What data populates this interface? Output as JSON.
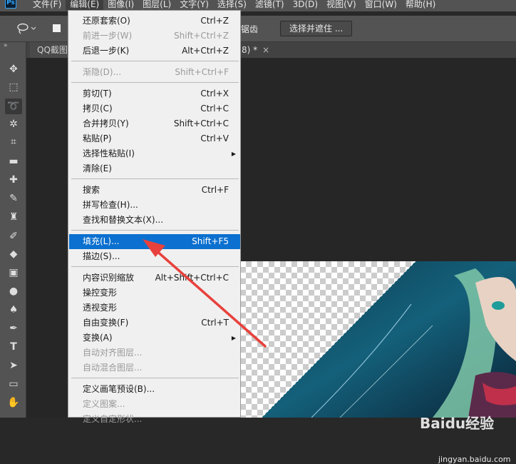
{
  "app": {
    "logo": "Ps"
  },
  "menubar": {
    "items": [
      {
        "label": "文件(F)"
      },
      {
        "label": "编辑(E)"
      },
      {
        "label": "图像(I)"
      },
      {
        "label": "图层(L)"
      },
      {
        "label": "文字(Y)"
      },
      {
        "label": "选择(S)"
      },
      {
        "label": "滤镜(T)"
      },
      {
        "label": "3D(D)"
      },
      {
        "label": "视图(V)"
      },
      {
        "label": "窗口(W)"
      },
      {
        "label": "帮助(H)"
      }
    ]
  },
  "options": {
    "antialias_label": "锯齿",
    "select_mask_button": "选择并遮住 ..."
  },
  "tabs": {
    "tab1": "QQ截图",
    "tab2": "8) *",
    "tab2_close": "×"
  },
  "edit_menu": {
    "items": [
      {
        "label": "还原套索(O)",
        "shortcut": "Ctrl+Z"
      },
      {
        "label": "前进一步(W)",
        "shortcut": "Shift+Ctrl+Z"
      },
      {
        "label": "后退一步(K)",
        "shortcut": "Alt+Ctrl+Z"
      },
      {
        "label": "渐隐(D)...",
        "shortcut": "Shift+Ctrl+F"
      },
      {
        "label": "剪切(T)",
        "shortcut": "Ctrl+X"
      },
      {
        "label": "拷贝(C)",
        "shortcut": "Ctrl+C"
      },
      {
        "label": "合并拷贝(Y)",
        "shortcut": "Shift+Ctrl+C"
      },
      {
        "label": "粘贴(P)",
        "shortcut": "Ctrl+V"
      },
      {
        "label": "选择性粘贴(I)",
        "shortcut": ""
      },
      {
        "label": "清除(E)",
        "shortcut": ""
      },
      {
        "label": "搜索",
        "shortcut": "Ctrl+F"
      },
      {
        "label": "拼写检查(H)...",
        "shortcut": ""
      },
      {
        "label": "查找和替换文本(X)...",
        "shortcut": ""
      },
      {
        "label": "填充(L)...",
        "shortcut": "Shift+F5"
      },
      {
        "label": "描边(S)...",
        "shortcut": ""
      },
      {
        "label": "内容识别缩放",
        "shortcut": "Alt+Shift+Ctrl+C"
      },
      {
        "label": "操控变形",
        "shortcut": ""
      },
      {
        "label": "透视变形",
        "shortcut": ""
      },
      {
        "label": "自由变换(F)",
        "shortcut": "Ctrl+T"
      },
      {
        "label": "变换(A)",
        "shortcut": ""
      },
      {
        "label": "自动对齐图层...",
        "shortcut": ""
      },
      {
        "label": "自动混合图层...",
        "shortcut": ""
      },
      {
        "label": "定义画笔预设(B)...",
        "shortcut": ""
      },
      {
        "label": "定义图案...",
        "shortcut": ""
      },
      {
        "label": "定义自定形状...",
        "shortcut": ""
      }
    ]
  },
  "watermark": {
    "text": "Baidu经验",
    "url": "jingyan.baidu.com"
  },
  "colors": {
    "highlight": "#0b70cf",
    "annotation_arrow": "#e8413c"
  }
}
